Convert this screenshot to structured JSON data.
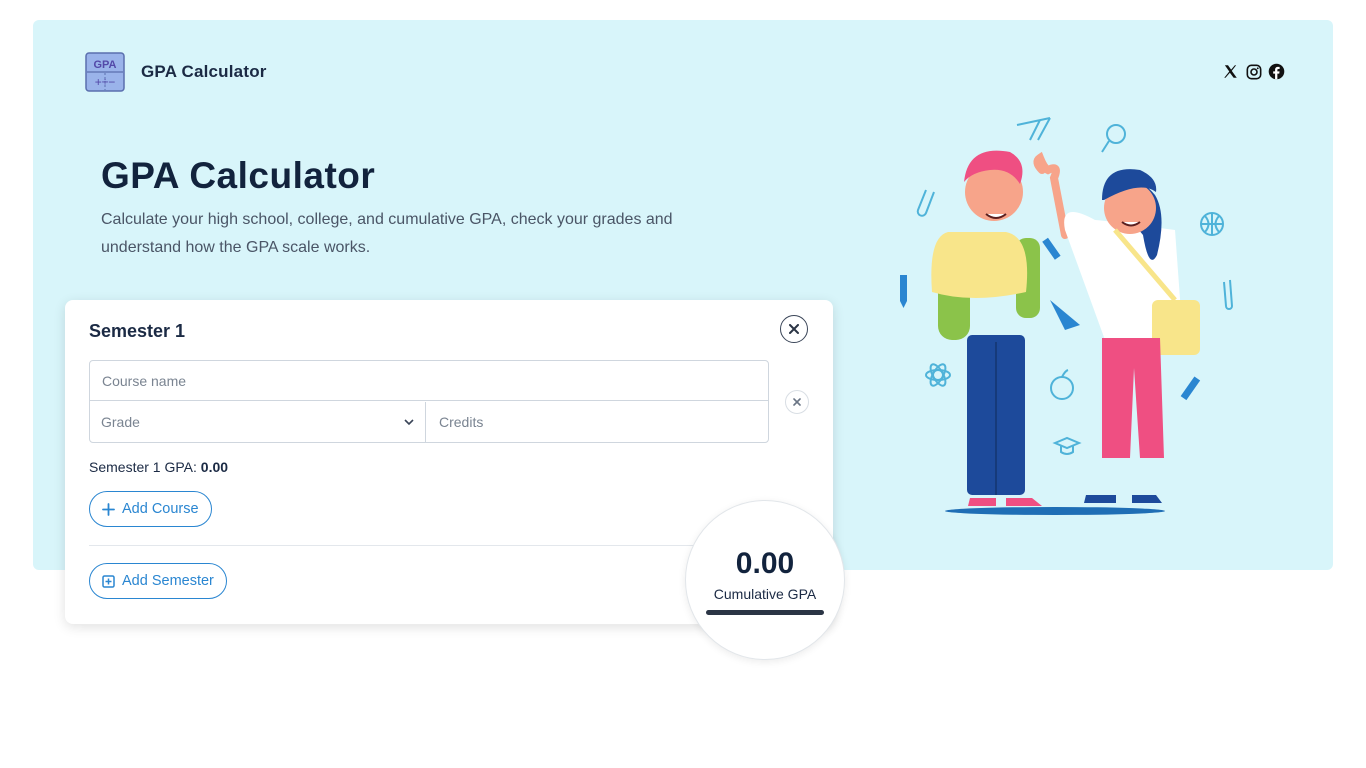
{
  "header": {
    "brand": "GPA Calculator",
    "logo_text_top": "GPA",
    "logo_text_bottom": "+÷−",
    "social_icons": [
      "x-icon",
      "instagram-icon",
      "facebook-icon"
    ]
  },
  "hero": {
    "title": "GPA Calculator",
    "subtitle": "Calculate your high school, college, and cumulative GPA, check your grades and understand how the GPA scale works."
  },
  "semester": {
    "title": "Semester 1",
    "course_placeholder": "Course name",
    "grade_placeholder": "Grade",
    "credits_placeholder": "Credits",
    "gpa_label": "Semester 1 GPA:",
    "gpa_value": "0.00",
    "add_course_label": "Add Course",
    "add_semester_label": "Add Semester"
  },
  "cumulative": {
    "value": "0.00",
    "label": "Cumulative GPA"
  },
  "colors": {
    "hero_bg": "#d8f5fa",
    "accent": "#2a86d1",
    "heading": "#12233d"
  }
}
